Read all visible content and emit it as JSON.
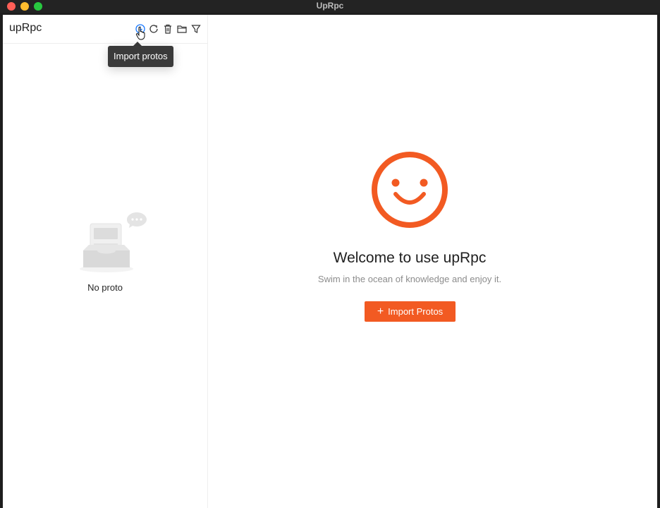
{
  "window": {
    "title": "UpRpc"
  },
  "sidebar": {
    "app_name": "upRpc",
    "toolbar": {
      "import_icon": "import-icon",
      "refresh_icon": "refresh-icon",
      "trash_icon": "trash-icon",
      "folder_icon": "folder-icon",
      "filter_icon": "filter-icon"
    },
    "tooltip": "Import protos",
    "empty_text": "No proto"
  },
  "main": {
    "welcome_title": "Welcome to use upRpc",
    "welcome_subtitle": "Swim in the ocean of knowledge and enjoy it.",
    "import_button_label": "Import Protos",
    "import_button_icon": "plus-icon"
  },
  "colors": {
    "accent": "#f25a22",
    "tooltip_bg": "#3a3a3a",
    "icon_active": "#1677ff"
  }
}
